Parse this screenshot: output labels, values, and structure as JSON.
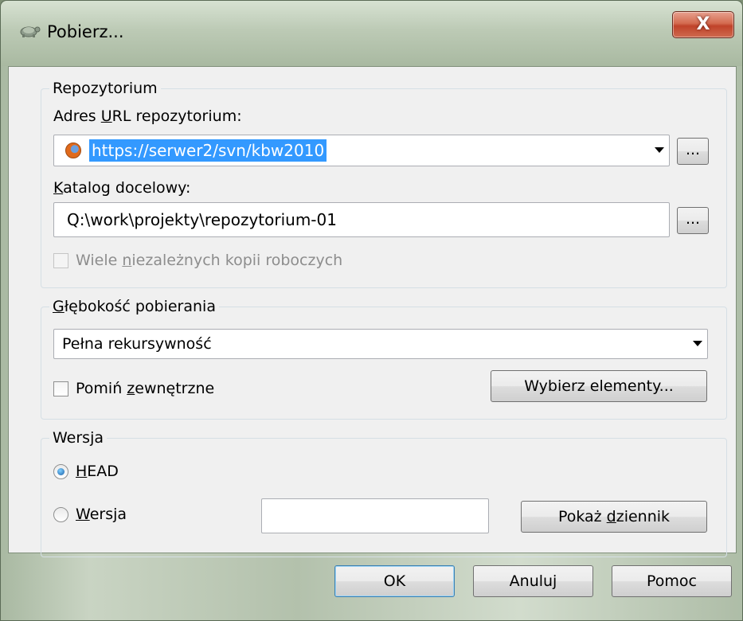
{
  "window": {
    "title": "Pobierz...",
    "close_label": "X"
  },
  "repository": {
    "group_title": "Repozytorium",
    "url_label": "Adres URL repozytorium:",
    "url_value": "https://serwer2/svn/kbw2010",
    "browse_label": "...",
    "target_label": "Katalog docelowy:",
    "target_value": "Q:\\work\\projekty\\repozytorium-01",
    "target_browse_label": "...",
    "multiple_wc_label": "Wiele niezależnych kopii roboczych",
    "multiple_wc_checked": false
  },
  "depth": {
    "group_title": "Głębokość pobierania",
    "selected": "Pełna rekursywność",
    "omit_externals_label": "Pomiń zewnętrzne",
    "omit_externals_checked": false,
    "choose_items_label": "Wybierz elementy..."
  },
  "revision": {
    "group_title": "Wersja",
    "head_label": "HEAD",
    "head_selected": true,
    "revision_label": "Wersja",
    "revision_value": "",
    "show_log_label": "Pokaż dziennik"
  },
  "buttons": {
    "ok": "OK",
    "cancel": "Anuluj",
    "help": "Pomoc"
  }
}
